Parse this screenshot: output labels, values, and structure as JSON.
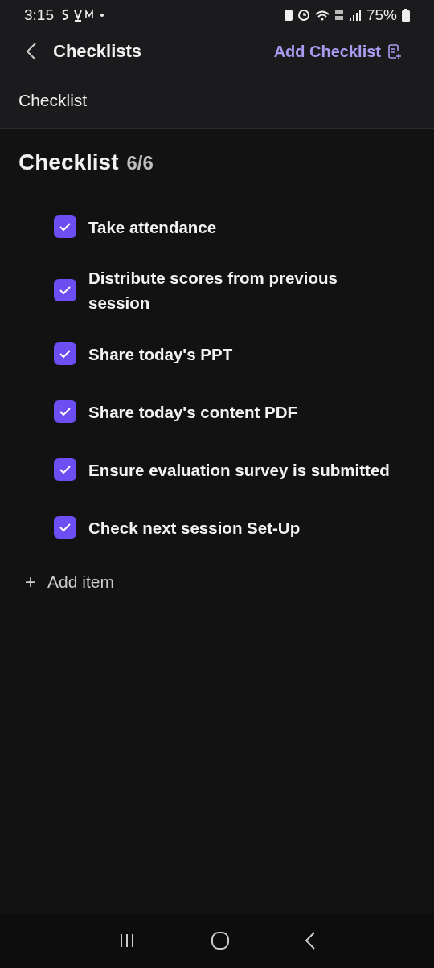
{
  "status_bar": {
    "time": "3:15",
    "battery": "75%"
  },
  "header": {
    "title": "Checklists",
    "action": "Add Checklist"
  },
  "subheader": {
    "title": "Checklist"
  },
  "checklist": {
    "title": "Checklist",
    "count": "6/6",
    "items": [
      {
        "label": "Take attendance",
        "checked": true
      },
      {
        "label": "Distribute scores from previous session",
        "checked": true
      },
      {
        "label": "Share today's PPT",
        "checked": true
      },
      {
        "label": "Share today's content PDF",
        "checked": true
      },
      {
        "label": "Ensure evaluation survey is submitted",
        "checked": true
      },
      {
        "label": "Check next session Set-Up",
        "checked": true
      }
    ],
    "add_item": {
      "icon": "+",
      "label": "Add item"
    }
  }
}
